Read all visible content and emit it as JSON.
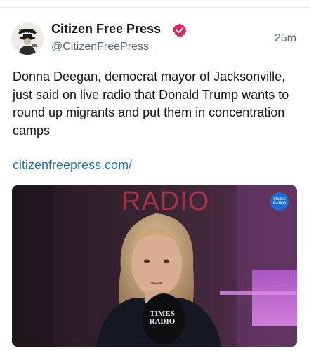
{
  "post": {
    "author_name": "Citizen Free Press",
    "author_handle": "@CitizenFreePress",
    "timestamp": "25m",
    "avatar_text": "KANE",
    "text": "Donna Deegan, democrat mayor of Jacksonville, just said on live radio that Donald Trump wants to round up migrants and put them in concentration camps",
    "link_text": "citizenfreepress.com/",
    "verified_color": "#e0245e"
  },
  "media": {
    "watermark": "RADIO",
    "logo_line1": "TIMES",
    "logo_line2": "RADIO",
    "mic_line1": "TIMES",
    "mic_line2": "RADIO"
  }
}
